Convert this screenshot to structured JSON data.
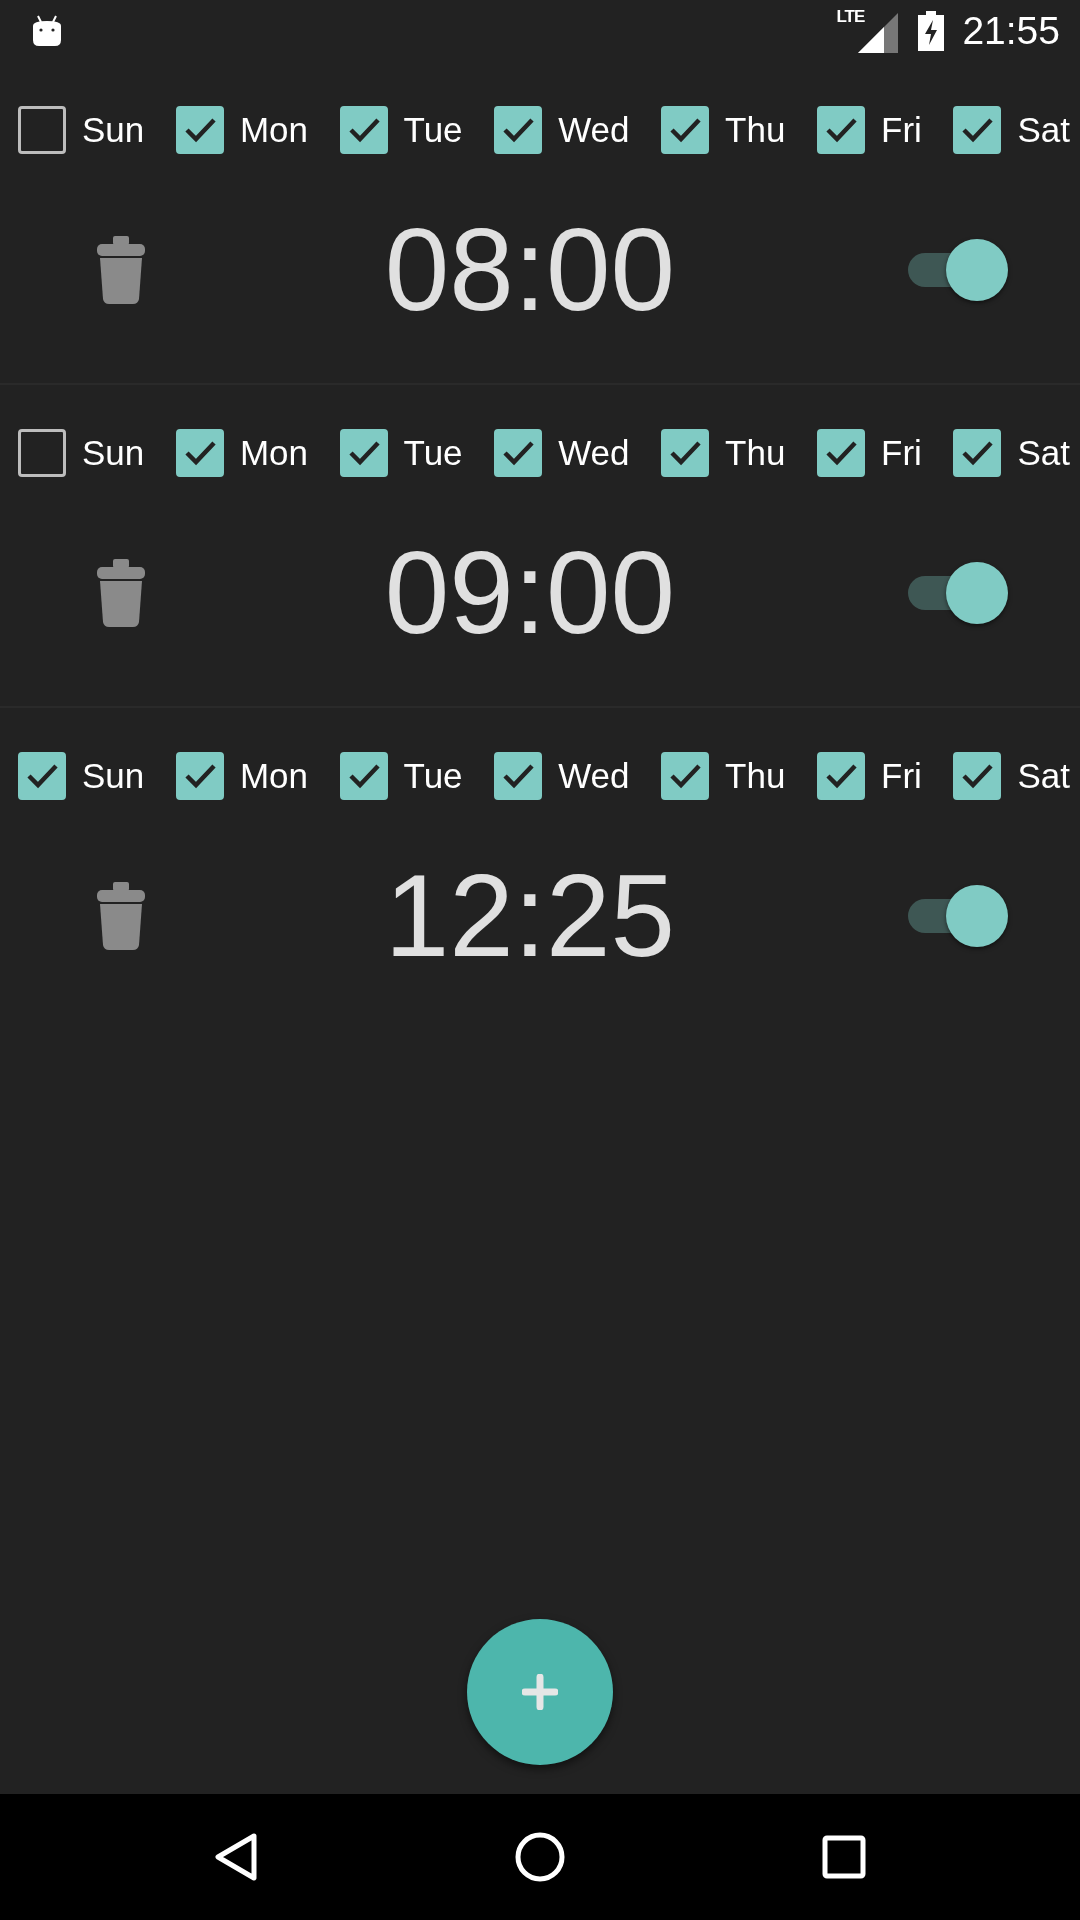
{
  "status_bar": {
    "network": "LTE",
    "time": "21:55"
  },
  "alarms": [
    {
      "days": [
        {
          "label": "Sun",
          "checked": false
        },
        {
          "label": "Mon",
          "checked": true
        },
        {
          "label": "Tue",
          "checked": true
        },
        {
          "label": "Wed",
          "checked": true
        },
        {
          "label": "Thu",
          "checked": true
        },
        {
          "label": "Fri",
          "checked": true
        },
        {
          "label": "Sat",
          "checked": true
        }
      ],
      "time": "08:00",
      "on": true
    },
    {
      "days": [
        {
          "label": "Sun",
          "checked": false
        },
        {
          "label": "Mon",
          "checked": true
        },
        {
          "label": "Tue",
          "checked": true
        },
        {
          "label": "Wed",
          "checked": true
        },
        {
          "label": "Thu",
          "checked": true
        },
        {
          "label": "Fri",
          "checked": true
        },
        {
          "label": "Sat",
          "checked": true
        }
      ],
      "time": "09:00",
      "on": true
    },
    {
      "days": [
        {
          "label": "Sun",
          "checked": true
        },
        {
          "label": "Mon",
          "checked": true
        },
        {
          "label": "Tue",
          "checked": true
        },
        {
          "label": "Wed",
          "checked": true
        },
        {
          "label": "Thu",
          "checked": true
        },
        {
          "label": "Fri",
          "checked": true
        },
        {
          "label": "Sat",
          "checked": true
        }
      ],
      "time": "12:25",
      "on": true
    }
  ]
}
